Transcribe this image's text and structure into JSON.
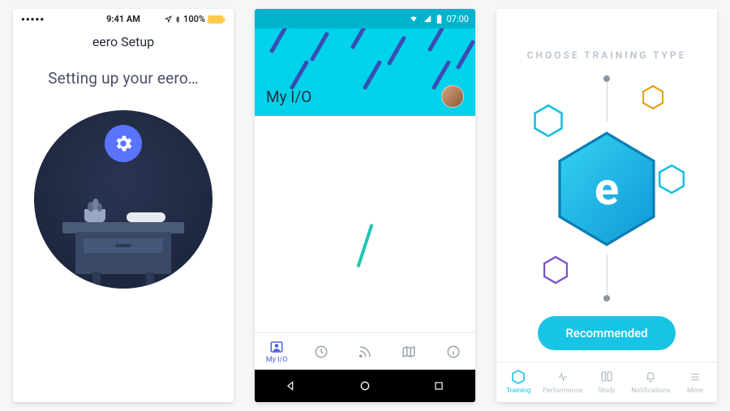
{
  "phone1": {
    "status": {
      "carrier_dots": "●●●●●",
      "time": "9:41 AM",
      "battery_pct": "100%"
    },
    "title": "eero Setup",
    "heading": "Setting up your eero…"
  },
  "phone2": {
    "status": {
      "time": "07:00"
    },
    "header_title": "My I/O",
    "tabs": [
      {
        "label": "My I/O"
      },
      {
        "label": ""
      },
      {
        "label": ""
      },
      {
        "label": ""
      },
      {
        "label": ""
      }
    ]
  },
  "phone3": {
    "heading": "CHOOSE TRAINING TYPE",
    "logo_letter": "e",
    "cta": "Recommended",
    "tabs": [
      {
        "label": "Training"
      },
      {
        "label": "Performance"
      },
      {
        "label": "Study"
      },
      {
        "label": "Notifications"
      },
      {
        "label": "More"
      }
    ]
  }
}
